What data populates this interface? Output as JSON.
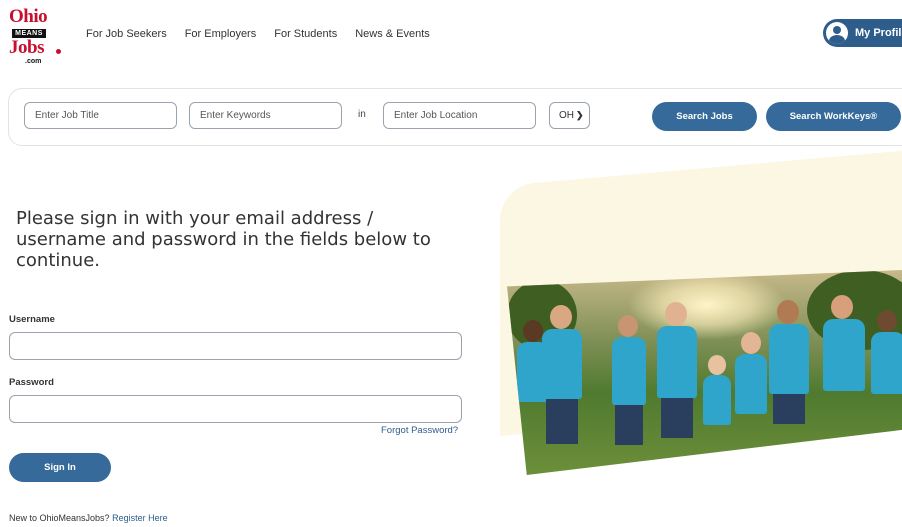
{
  "logo": {
    "ohio": "Ohio",
    "means": "MEANS",
    "jobs": "Jobs",
    "com": ".com"
  },
  "nav": {
    "items": [
      "For Job Seekers",
      "For Employers",
      "For Students",
      "News & Events"
    ]
  },
  "profile": {
    "label": "My Profile"
  },
  "search": {
    "job_title_placeholder": "Enter Job Title",
    "keywords_placeholder": "Enter Keywords",
    "in_label": "in",
    "location_placeholder": "Enter Job Location",
    "state_value": "OH",
    "search_jobs_label": "Search Jobs",
    "search_workkeys_label": "Search WorkKeys®"
  },
  "signin": {
    "heading": "Please sign in with your email address / username and password in the fields below to continue.",
    "username_label": "Username",
    "password_label": "Password",
    "forgot_label": "Forgot Password?",
    "signin_label": "Sign In",
    "new_prefix": "New to OhioMeansJobs?",
    "register_label": "Register Here"
  },
  "colors": {
    "brand_red": "#c8102e",
    "button_blue": "#356a9a",
    "link_blue": "#2e5d8c"
  }
}
